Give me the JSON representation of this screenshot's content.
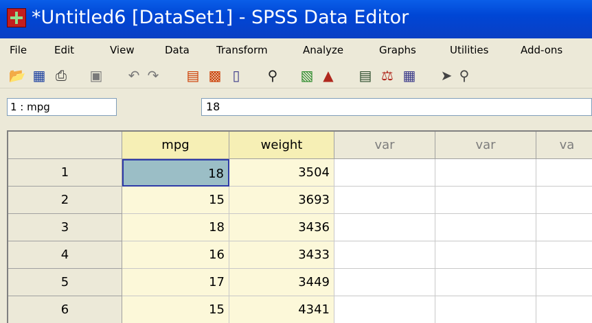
{
  "window": {
    "title": "*Untitled6 [DataSet1] - SPSS Data Editor"
  },
  "menu": [
    "File",
    "Edit",
    "View",
    "Data",
    "Transform",
    "Analyze",
    "Graphs",
    "Utilities",
    "Add-ons"
  ],
  "toolbar": {
    "icons": [
      "open-icon",
      "save-icon",
      "print-icon",
      "dialog-recall-icon",
      "undo-icon",
      "redo-icon",
      "goto-case-icon",
      "goto-variable-icon",
      "variables-icon",
      "find-icon",
      "insert-cases-icon",
      "insert-variable-icon",
      "split-file-icon",
      "weight-cases-icon",
      "select-cases-icon",
      "value-labels-icon",
      "use-sets-icon"
    ]
  },
  "cellbar": {
    "ref": "1 : mpg",
    "value": "18"
  },
  "grid": {
    "columns": [
      "mpg",
      "weight",
      "var",
      "var",
      "va"
    ],
    "rows": [
      {
        "num": "1",
        "mpg": "18",
        "weight": "3504"
      },
      {
        "num": "2",
        "mpg": "15",
        "weight": "3693"
      },
      {
        "num": "3",
        "mpg": "18",
        "weight": "3436"
      },
      {
        "num": "4",
        "mpg": "16",
        "weight": "3433"
      },
      {
        "num": "5",
        "mpg": "17",
        "weight": "3449"
      },
      {
        "num": "6",
        "mpg": "15",
        "weight": "4341"
      }
    ],
    "selected": {
      "row": 0,
      "column": "mpg"
    }
  },
  "colors": {
    "title_bar": "#0a5ee8",
    "data_column": "#fcf8d9",
    "selected_cell": "#9bbec6"
  }
}
